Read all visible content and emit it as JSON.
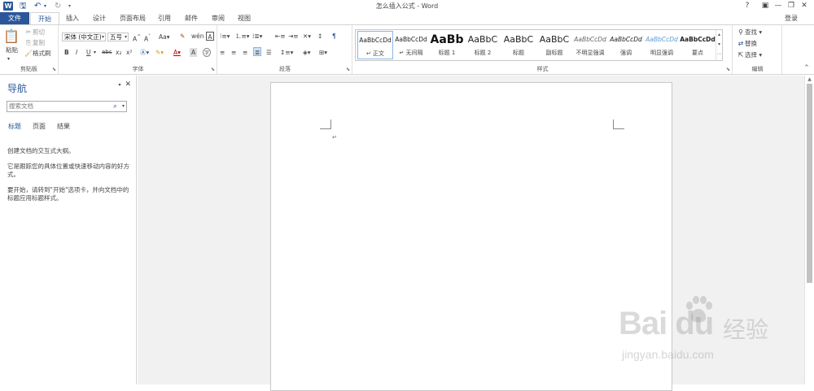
{
  "titlebar": {
    "title": "怎么插入公式 - Word",
    "help": "?",
    "controls": [
      "▣",
      "—",
      "❐",
      "✕"
    ]
  },
  "tabs": [
    "文件",
    "开始",
    "插入",
    "设计",
    "页面布局",
    "引用",
    "邮件",
    "审阅",
    "视图"
  ],
  "login": "登录",
  "ribbon": {
    "clipboard": {
      "label": "剪贴板",
      "paste": "粘贴",
      "cut": "剪切",
      "copy": "复制",
      "format_painter": "格式刷"
    },
    "font": {
      "label": "字体",
      "font_name": "宋体 (中文正)",
      "font_size": "五号",
      "buttons": [
        "B",
        "I",
        "U",
        "abc",
        "x₂",
        "x²"
      ]
    },
    "paragraph": {
      "label": "段落"
    },
    "styles": {
      "label": "样式",
      "items": [
        {
          "preview": "AaBbCcDd",
          "name": "↵ 正文"
        },
        {
          "preview": "AaBbCcDd",
          "name": "↵ 无间隔"
        },
        {
          "preview": "AaBb",
          "name": "标题 1"
        },
        {
          "preview": "AaBbC",
          "name": "标题 2"
        },
        {
          "preview": "AaBbC",
          "name": "标题"
        },
        {
          "preview": "AaBbC",
          "name": "副标题"
        },
        {
          "preview": "AaBbCcDd",
          "name": "不明显强调"
        },
        {
          "preview": "AaBbCcDd",
          "name": "强调"
        },
        {
          "preview": "AaBbCcDd",
          "name": "明显强调"
        },
        {
          "preview": "AaBbCcDd",
          "name": "要点"
        }
      ]
    },
    "editing": {
      "label": "编辑",
      "find": "查找",
      "replace": "替换",
      "select": "选择"
    }
  },
  "navpane": {
    "title": "导航",
    "search_placeholder": "搜索文档",
    "tabs": [
      "标题",
      "页面",
      "结果"
    ],
    "text1": "创建文档的交互式大纲。",
    "text2": "它是跟踪您的具体位置或快速移动内容的好方式。",
    "text3": "要开始，请转到\"开始\"选项卡，并向文档中的标题应用标题样式。"
  },
  "document": {
    "paragraph_mark": "↵"
  },
  "watermark": {
    "logo": "Bai du",
    "cn": "经验",
    "url": "jingyan.baidu.com"
  }
}
